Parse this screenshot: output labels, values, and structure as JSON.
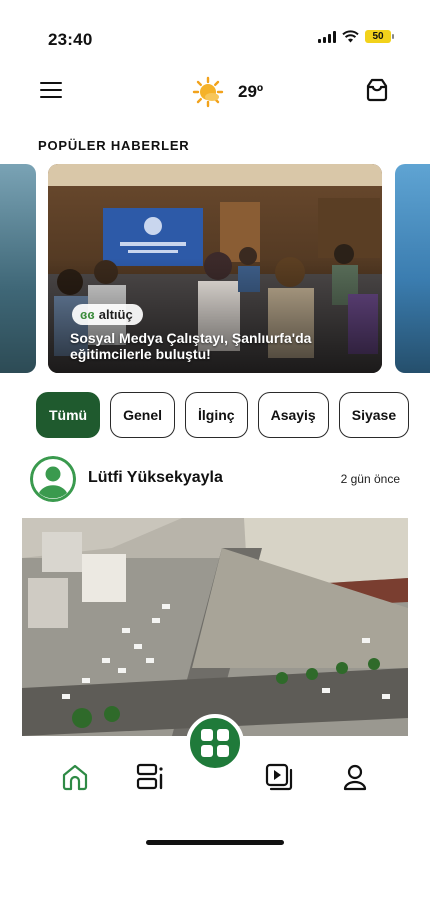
{
  "status_bar": {
    "time": "23:40",
    "battery": "50"
  },
  "header": {
    "temperature": "29º",
    "weather_icon": "sun-cloud-icon"
  },
  "popular": {
    "title": "POPÜLER HABERLER",
    "featured": {
      "source_logo": "altıüç",
      "headline": "Sosyal Medya Çalıştayı, Şanlıurfa'da eğitimcilerle buluştu!"
    }
  },
  "categories": [
    {
      "label": "Tümü",
      "active": true
    },
    {
      "label": "Genel",
      "active": false
    },
    {
      "label": "İlginç",
      "active": false
    },
    {
      "label": "Asayiş",
      "active": false
    },
    {
      "label": "Siyase",
      "active": false
    }
  ],
  "post": {
    "author": "Lütfi Yüksekyayla",
    "time_ago": "2 gün önce"
  },
  "nav": {
    "items": [
      "home-icon",
      "news-list-icon",
      "grid-apps-icon",
      "video-icon",
      "profile-icon"
    ]
  },
  "colors": {
    "accent": "#1f5a2e",
    "accent_light": "#2e8a45",
    "chip_border": "#2a2a2a"
  }
}
